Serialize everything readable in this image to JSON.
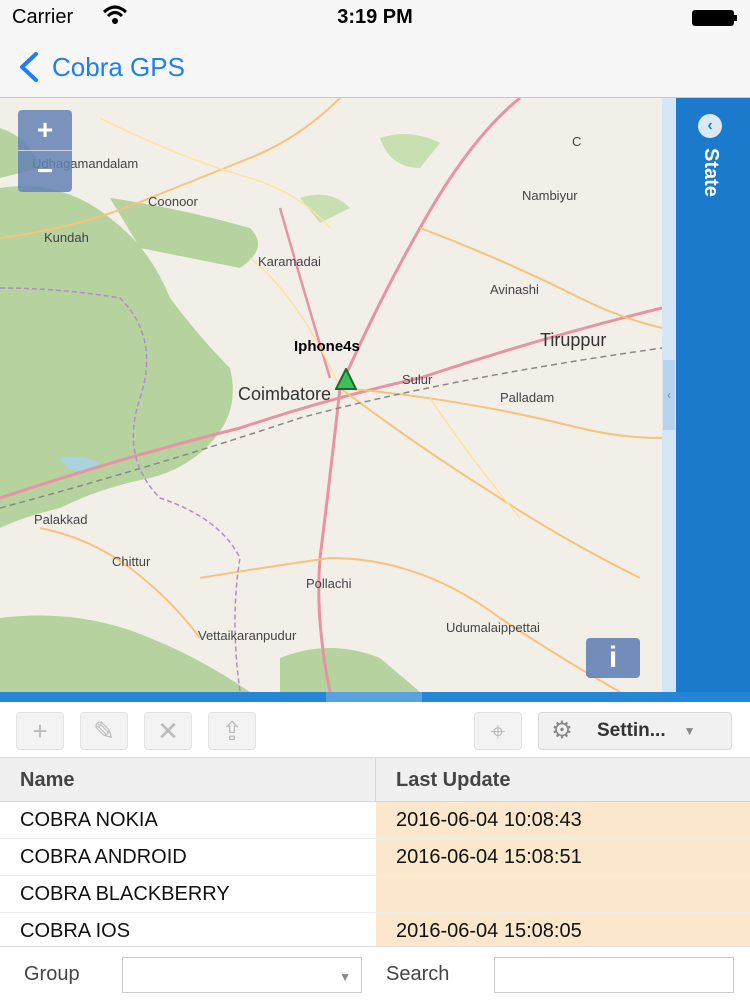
{
  "status_bar": {
    "carrier": "Carrier",
    "time": "3:19 PM"
  },
  "nav": {
    "back_label": "Cobra GPS",
    "accent_color": "#1e7ef5"
  },
  "map": {
    "zoom_in": "+",
    "zoom_out": "−",
    "info": "i",
    "marker_label": "Iphone4s",
    "places": {
      "udhagamandalam": "Udhagamandalam",
      "coonoor": "Coonoor",
      "kundah": "Kundah",
      "karamadai": "Karamadai",
      "nambiyur": "Nambiyur",
      "avinashi": "Avinashi",
      "tiruppur": "Tiruppur",
      "coimbatore": "Coimbatore",
      "sulur": "Sulur",
      "palladam": "Palladam",
      "palakkad": "Palakkad",
      "chittur": "Chittur",
      "pollachi": "Pollachi",
      "udumalaippettai": "Udumalaippettai",
      "vettaikaranpudur": "Vettaikaranpudur",
      "c": "C"
    }
  },
  "state_panel": {
    "title": "State",
    "color": "#1b7acb"
  },
  "toolbar": {
    "add_icon": "+",
    "edit_icon": "✎",
    "remove_icon": "✕",
    "upload_icon": "⇪",
    "locate_icon": "⌖",
    "settings_label": "Settin...",
    "settings_icon": "⚙"
  },
  "table": {
    "columns": [
      "Name",
      "Last Update"
    ],
    "rows": [
      {
        "name": "COBRA NOKIA",
        "last_update": "2016-06-04 10:08:43"
      },
      {
        "name": "COBRA ANDROID",
        "last_update": "2016-06-04 15:08:51"
      },
      {
        "name": "COBRA BLACKBERRY",
        "last_update": ""
      },
      {
        "name": "COBRA IOS",
        "last_update": "2016-06-04 15:08:05"
      }
    ]
  },
  "footer": {
    "group_label": "Group",
    "group_value": "",
    "search_label": "Search",
    "search_value": ""
  }
}
